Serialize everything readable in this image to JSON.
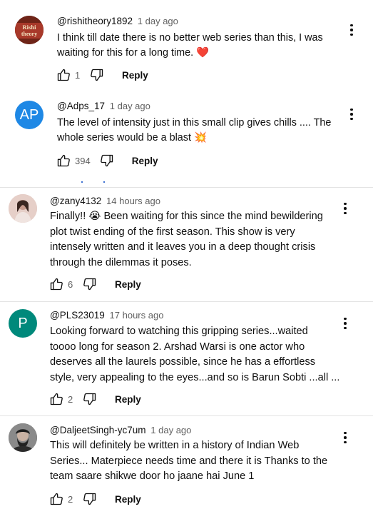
{
  "comments": [
    {
      "handle": "@rishitheory1892",
      "time": "1 day ago",
      "avatar_text": "Rishi theory",
      "avatar_color": "#8c2d1e",
      "text": "I think till date there is no better web series than this, I was\nwaiting for this for a long time. ❤️",
      "likes": "1",
      "reply_label": "Reply"
    },
    {
      "handle": "@Adps_17",
      "time": "1 day ago",
      "avatar_text": "AP",
      "avatar_color": "#1e88e5",
      "text": "The level of intensity just in this small clip gives chills .... The\nwhole series would be a blast 💥",
      "likes": "394",
      "reply_label": "Reply"
    },
    {
      "handle": "@zany4132",
      "time": "14 hours ago",
      "avatar_text": "",
      "avatar_color": "#d9b9b2",
      "text": "Finally!! 😭 Been waiting for this since the mind bewildering\nplot twist ending of the first season. This show is very\nintensely written and it leaves you in a deep thought crisis\nthrough the dilemmas it poses.",
      "likes": "6",
      "reply_label": "Reply"
    },
    {
      "handle": "@PLS23019",
      "time": "17 hours ago",
      "avatar_text": "P",
      "avatar_color": "#00897b",
      "text": "Looking forward to watching this gripping series...waited\ntoooo long for season 2. Arshad Warsi  is one actor who\ndeserves all the laurels possible,  since he has a effortless\nstyle, very appealing to the eyes...and so is Barun Sobti ...all ...",
      "likes": "2",
      "reply_label": "Reply"
    },
    {
      "handle": "@DaljeetSingh-yc7um",
      "time": "1 day ago",
      "avatar_text": "",
      "avatar_color": "#3a3a3a",
      "text": "This will definitely be written in a history of Indian Web\nSeries... Materpiece needs time and there it is Thanks to the\nteam saare shikwe door ho jaane hai June 1",
      "likes": "2",
      "reply_label": "Reply"
    }
  ],
  "icons": {
    "like": "thumbs-up-icon",
    "dislike": "thumbs-down-icon",
    "menu": "more-vert-icon"
  }
}
